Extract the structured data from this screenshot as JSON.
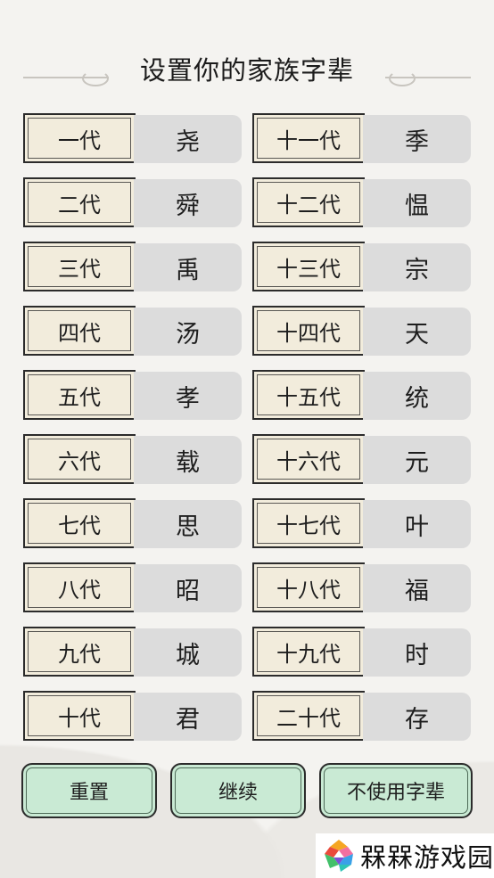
{
  "title": "设置你的家族字辈",
  "generations": [
    {
      "label": "一代",
      "value": "尧"
    },
    {
      "label": "二代",
      "value": "舜"
    },
    {
      "label": "三代",
      "value": "禹"
    },
    {
      "label": "四代",
      "value": "汤"
    },
    {
      "label": "五代",
      "value": "孝"
    },
    {
      "label": "六代",
      "value": "载"
    },
    {
      "label": "七代",
      "value": "思"
    },
    {
      "label": "八代",
      "value": "昭"
    },
    {
      "label": "九代",
      "value": "城"
    },
    {
      "label": "十代",
      "value": "君"
    },
    {
      "label": "十一代",
      "value": "季"
    },
    {
      "label": "十二代",
      "value": "愠"
    },
    {
      "label": "十三代",
      "value": "宗"
    },
    {
      "label": "十四代",
      "value": "天"
    },
    {
      "label": "十五代",
      "value": "统"
    },
    {
      "label": "十六代",
      "value": "元"
    },
    {
      "label": "十七代",
      "value": "叶"
    },
    {
      "label": "十八代",
      "value": "福"
    },
    {
      "label": "十九代",
      "value": "时"
    },
    {
      "label": "二十代",
      "value": "存"
    }
  ],
  "buttons": {
    "reset": "重置",
    "continue": "继续",
    "no_generation": "不使用字辈"
  },
  "watermark": {
    "text": "槑槑游戏园",
    "icon": "colorful-s-logo-icon"
  }
}
